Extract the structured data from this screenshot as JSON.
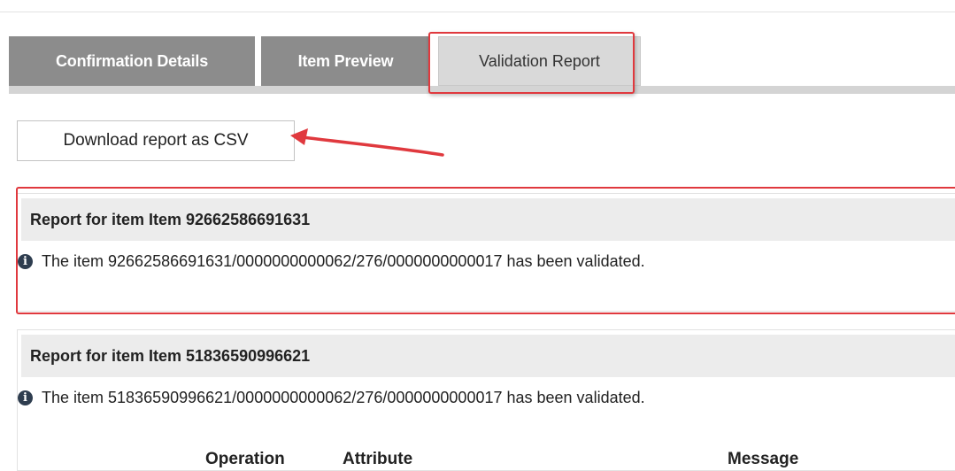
{
  "tabs": [
    {
      "label": "Confirmation Details",
      "active": false
    },
    {
      "label": "Item Preview",
      "active": false
    },
    {
      "label": "Validation Report",
      "active": true
    }
  ],
  "actions": {
    "download_csv_label": "Download report as CSV"
  },
  "reports": [
    {
      "title": "Report for item Item 92662586691631",
      "message": "The item 92662586691631/0000000000062/276/0000000000017 has been validated."
    },
    {
      "title": "Report for item Item 51836590996621",
      "message": "The item 51836590996621/0000000000062/276/0000000000017 has been validated.",
      "columns": [
        "Operation",
        "Attribute",
        "Message"
      ]
    }
  ],
  "colors": {
    "annotation_red": "#e0393e",
    "tab_inactive": "#8c8c8c",
    "tab_active": "#d9d9d9",
    "report_header_bg": "#ececec",
    "info_icon": "#2e3d4f"
  },
  "icons": {
    "info": "info-circle-icon",
    "arrow": "annotation-arrow"
  }
}
